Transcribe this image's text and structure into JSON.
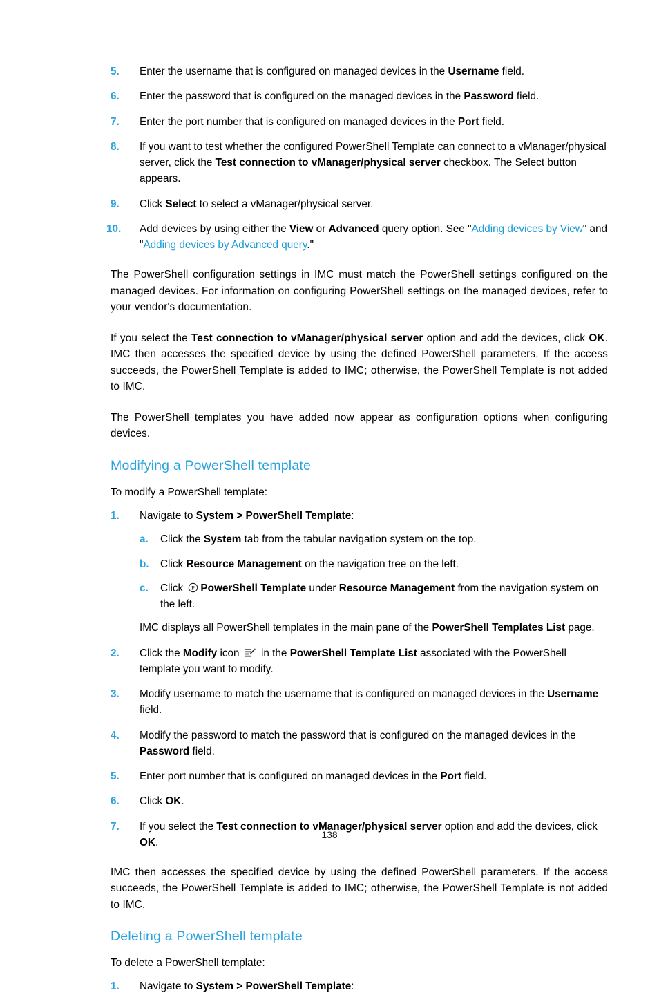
{
  "document": {
    "page_number": "138",
    "accent_color": "#2aa3dd",
    "link_color": "#1b9ad6",
    "text_color": "#000000"
  },
  "steps_top": {
    "items": [
      {
        "marker": "5.",
        "segments": [
          {
            "text": "Enter the username that is configured on managed devices in the ",
            "style": "normal"
          },
          {
            "text": "Username",
            "style": "bold"
          },
          {
            "text": " field.",
            "style": "normal"
          }
        ]
      },
      {
        "marker": "6.",
        "segments": [
          {
            "text": "Enter the password that is configured on the managed devices in the ",
            "style": "normal"
          },
          {
            "text": "Password",
            "style": "bold"
          },
          {
            "text": " field.",
            "style": "normal"
          }
        ]
      },
      {
        "marker": "7.",
        "segments": [
          {
            "text": "Enter the port number that is configured on managed devices in the ",
            "style": "normal"
          },
          {
            "text": "Port",
            "style": "bold"
          },
          {
            "text": " field.",
            "style": "normal"
          }
        ]
      },
      {
        "marker": "8.",
        "segments": [
          {
            "text": "If you want to test whether the configured PowerShell Template can connect to a vManager/physical server, click the ",
            "style": "normal"
          },
          {
            "text": "Test connection to vManager/physical server",
            "style": "bold"
          },
          {
            "text": " checkbox. The Select button appears.",
            "style": "normal"
          }
        ]
      },
      {
        "marker": "9.",
        "segments": [
          {
            "text": "Click ",
            "style": "normal"
          },
          {
            "text": "Select",
            "style": "bold"
          },
          {
            "text": " to select a vManager/physical server.",
            "style": "normal"
          }
        ]
      },
      {
        "marker": "10.",
        "segments": [
          {
            "text": "Add devices by using either the ",
            "style": "normal"
          },
          {
            "text": "View",
            "style": "bold"
          },
          {
            "text": " or ",
            "style": "normal"
          },
          {
            "text": "Advanced",
            "style": "bold"
          },
          {
            "text": " query option. See \"",
            "style": "normal"
          },
          {
            "text": "Adding devices by View",
            "style": "link"
          },
          {
            "text": "\" and \"",
            "style": "normal"
          },
          {
            "text": "Adding devices by Advanced query",
            "style": "link"
          },
          {
            "text": ".\"",
            "style": "normal"
          }
        ]
      }
    ]
  },
  "paragraphs_mid": [
    {
      "id": "para-powershell-config",
      "segments": [
        {
          "text": "The PowerShell configuration settings in IMC must match the PowerShell settings configured on the managed devices. For information on configuring PowerShell settings on the managed devices, refer to your vendor's documentation.",
          "style": "normal"
        }
      ]
    },
    {
      "id": "para-test-connection",
      "segments": [
        {
          "text": "If you select the ",
          "style": "normal"
        },
        {
          "text": "Test connection to vManager/physical server",
          "style": "bold"
        },
        {
          "text": " option and add the devices, click ",
          "style": "normal"
        },
        {
          "text": "OK",
          "style": "bold"
        },
        {
          "text": ". IMC then accesses the specified device by using the defined PowerShell parameters. If the access succeeds, the PowerShell Template is added to IMC; otherwise, the PowerShell Template is not added to IMC.",
          "style": "normal"
        }
      ]
    },
    {
      "id": "para-templates-appear",
      "segments": [
        {
          "text": "The PowerShell templates you have added now appear as configuration options when configuring devices.",
          "style": "normal"
        }
      ]
    }
  ],
  "modify_section": {
    "heading": "Modifying a PowerShell template",
    "intro": "To modify a PowerShell template:",
    "steps": [
      {
        "marker": "1.",
        "segments": [
          {
            "text": "Navigate to ",
            "style": "normal"
          },
          {
            "text": "System > PowerShell Template",
            "style": "bold"
          },
          {
            "text": ":",
            "style": "normal"
          }
        ],
        "substeps": [
          {
            "marker": "a.",
            "segments": [
              {
                "text": "Click the ",
                "style": "normal"
              },
              {
                "text": "System",
                "style": "bold"
              },
              {
                "text": " tab from the tabular navigation system on the top.",
                "style": "normal"
              }
            ]
          },
          {
            "marker": "b.",
            "segments": [
              {
                "text": "Click ",
                "style": "normal"
              },
              {
                "text": "Resource Management",
                "style": "bold"
              },
              {
                "text": " on the navigation tree on the left.",
                "style": "normal"
              }
            ]
          },
          {
            "marker": "c.",
            "segments": [
              {
                "text": "Click ",
                "style": "normal"
              },
              {
                "text": "__ICON_P__",
                "style": "icon"
              },
              {
                "text": "PowerShell Template",
                "style": "bold"
              },
              {
                "text": " under ",
                "style": "normal"
              },
              {
                "text": "Resource Management",
                "style": "bold"
              },
              {
                "text": " from the navigation system on the left.",
                "style": "normal"
              }
            ]
          }
        ],
        "note": [
          {
            "text": "IMC displays all PowerShell templates in the main pane of the ",
            "style": "normal"
          },
          {
            "text": "PowerShell Templates List",
            "style": "bold"
          },
          {
            "text": " page.",
            "style": "normal"
          }
        ]
      },
      {
        "marker": "2.",
        "segments": [
          {
            "text": "Click the ",
            "style": "normal"
          },
          {
            "text": "Modify",
            "style": "bold"
          },
          {
            "text": " icon ",
            "style": "normal"
          },
          {
            "text": "__ICON_MODIFY__",
            "style": "icon"
          },
          {
            "text": " in the ",
            "style": "normal"
          },
          {
            "text": "PowerShell Template List",
            "style": "bold"
          },
          {
            "text": " associated with the PowerShell template you want to modify.",
            "style": "normal"
          }
        ]
      },
      {
        "marker": "3.",
        "segments": [
          {
            "text": "Modify username to match the username that is configured on managed devices in the ",
            "style": "normal"
          },
          {
            "text": "Username",
            "style": "bold"
          },
          {
            "text": " field.",
            "style": "normal"
          }
        ]
      },
      {
        "marker": "4.",
        "segments": [
          {
            "text": "Modify the password to match the password that is configured on the managed devices in the ",
            "style": "normal"
          },
          {
            "text": "Password",
            "style": "bold"
          },
          {
            "text": " field.",
            "style": "normal"
          }
        ]
      },
      {
        "marker": "5.",
        "segments": [
          {
            "text": "Enter port number that is configured on managed devices in the ",
            "style": "normal"
          },
          {
            "text": "Port",
            "style": "bold"
          },
          {
            "text": " field.",
            "style": "normal"
          }
        ]
      },
      {
        "marker": "6.",
        "segments": [
          {
            "text": "Click ",
            "style": "normal"
          },
          {
            "text": "OK",
            "style": "bold"
          },
          {
            "text": ".",
            "style": "normal"
          }
        ]
      },
      {
        "marker": "7.",
        "segments": [
          {
            "text": "If you select the ",
            "style": "normal"
          },
          {
            "text": "Test connection to vManager/physical server",
            "style": "bold"
          },
          {
            "text": " option and add the devices, click ",
            "style": "normal"
          },
          {
            "text": "OK",
            "style": "bold"
          },
          {
            "text": ".",
            "style": "normal"
          }
        ]
      }
    ],
    "closing_paragraph": [
      {
        "text": "IMC then accesses the specified device by using the defined PowerShell parameters. If the access succeeds, the PowerShell Template is added to IMC; otherwise, the PowerShell Template is not added to IMC.",
        "style": "normal"
      }
    ]
  },
  "delete_section": {
    "heading": "Deleting a PowerShell template",
    "intro": "To delete a PowerShell template:",
    "steps": [
      {
        "marker": "1.",
        "segments": [
          {
            "text": "Navigate to ",
            "style": "normal"
          },
          {
            "text": "System > PowerShell Template",
            "style": "bold"
          },
          {
            "text": ":",
            "style": "normal"
          }
        ]
      }
    ]
  },
  "icons": {
    "powershell_template_icon": "circled-p-icon",
    "modify_icon": "modify-pencil-icon"
  }
}
